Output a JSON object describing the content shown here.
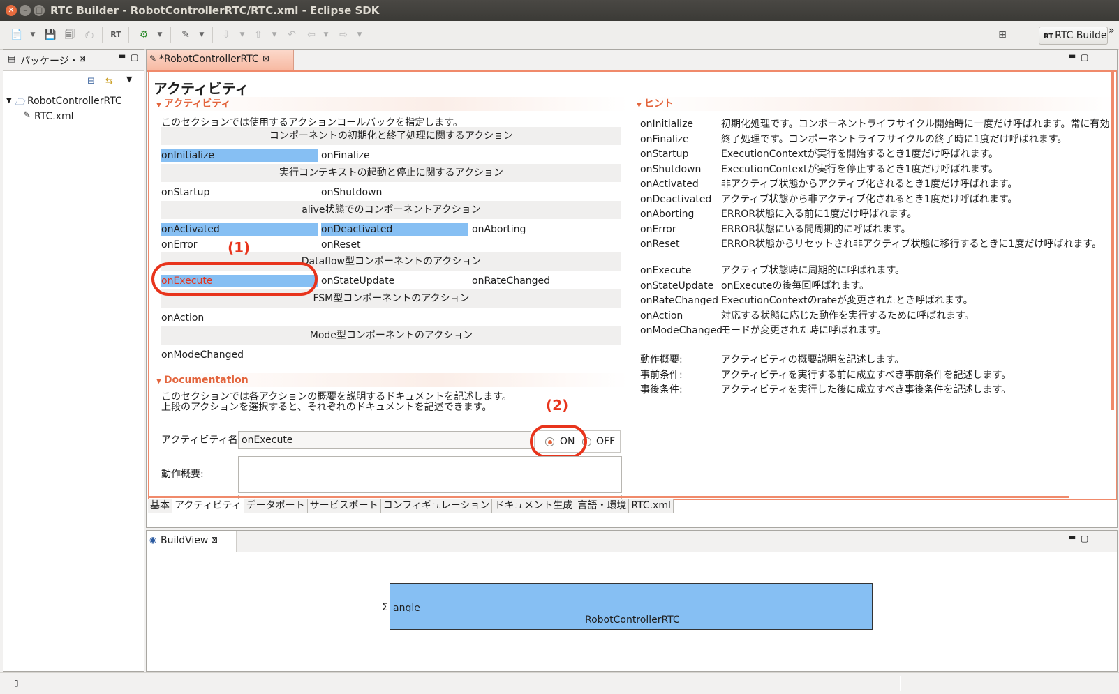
{
  "window": {
    "title": "RTC Builder - RobotControllerRTC/RTC.xml - Eclipse SDK"
  },
  "toolbar": {
    "perspective_label": "RTC Builde",
    "overflow": "»"
  },
  "package_explorer": {
    "tab_label": "パッケージ・",
    "tree": {
      "project": "RobotControllerRTC",
      "file": "RTC.xml"
    }
  },
  "editor": {
    "tab_label": "*RobotControllerRTC",
    "page_title": "アクティビティ",
    "activity_section": {
      "header": "アクティビティ",
      "description": "このセクションでは使用するアクションコールバックを指定します。",
      "groups": [
        {
          "title": "コンポーネントの初期化と終了処理に関するアクション",
          "actions": [
            "onInitialize",
            "onFinalize"
          ]
        },
        {
          "title": "実行コンテキストの起動と停止に関するアクション",
          "actions": [
            "onStartup",
            "onShutdown"
          ]
        },
        {
          "title": "alive状態でのコンポーネントアクション",
          "actions": [
            "onActivated",
            "onDeactivated",
            "onAborting",
            "onError",
            "onReset"
          ]
        },
        {
          "title": "Dataflow型コンポーネントのアクション",
          "actions": [
            "onExecute",
            "onStateUpdate",
            "onRateChanged"
          ]
        },
        {
          "title": "FSM型コンポーネントのアクション",
          "actions": [
            "onAction"
          ]
        },
        {
          "title": "Mode型コンポーネントのアクション",
          "actions": [
            "onModeChanged"
          ]
        }
      ]
    },
    "documentation_section": {
      "header": "Documentation",
      "description_line1": "このセクションでは各アクションの概要を説明するドキュメントを記述します。",
      "description_line2": "上段のアクションを選択すると、それぞれのドキュメントを記述できます。",
      "activity_name_label": "アクティビティ名 :",
      "activity_name_value": "onExecute",
      "radio_on": "ON",
      "radio_off": "OFF",
      "radio_selected": "ON",
      "summary_label": "動作概要:"
    },
    "hint_section": {
      "header": "ヒント",
      "hints": [
        {
          "key": "onInitialize",
          "text": "初期化処理です。コンポーネントライフサイクル開始時に一度だけ呼ばれます。常に有効"
        },
        {
          "key": "onFinalize",
          "text": "終了処理です。コンポーネントライフサイクルの終了時に1度だけ呼ばれます。"
        },
        {
          "key": "onStartup",
          "text": "ExecutionContextが実行を開始するとき1度だけ呼ばれます。"
        },
        {
          "key": "onShutdown",
          "text": "ExecutionContextが実行を停止するとき1度だけ呼ばれます。"
        },
        {
          "key": "onActivated",
          "text": "非アクティブ状態からアクティブ化されるとき1度だけ呼ばれます。"
        },
        {
          "key": "onDeactivated",
          "text": "アクティブ状態から非アクティブ化されるとき1度だけ呼ばれます。"
        },
        {
          "key": "onAborting",
          "text": "ERROR状態に入る前に1度だけ呼ばれます。"
        },
        {
          "key": "onError",
          "text": "ERROR状態にいる間周期的に呼ばれます。"
        },
        {
          "key": "onReset",
          "text": "ERROR状態からリセットされ非アクティブ状態に移行するときに1度だけ呼ばれます。"
        },
        {
          "key": "onExecute",
          "text": "アクティブ状態時に周期的に呼ばれます。"
        },
        {
          "key": "onStateUpdate",
          "text": "onExecuteの後毎回呼ばれます。"
        },
        {
          "key": "onRateChanged",
          "text": "ExecutionContextのrateが変更されたとき呼ばれます。"
        },
        {
          "key": "onAction",
          "text": "対応する状態に応じた動作を実行するために呼ばれます。"
        },
        {
          "key": "onModeChanged",
          "text": "モードが変更された時に呼ばれます。"
        },
        {
          "key": "動作概要:",
          "text": "アクティビティの概要説明を記述します。"
        },
        {
          "key": "事前条件:",
          "text": "アクティビティを実行する前に成立すべき事前条件を記述します。"
        },
        {
          "key": "事後条件:",
          "text": "アクティビティを実行した後に成立すべき事後条件を記述します。"
        }
      ]
    },
    "bottom_tabs": [
      "基本",
      "アクティビティ",
      "データポート",
      "サービスポート",
      "コンフィギュレーション",
      "ドキュメント生成",
      "言語・環境",
      "RTC.xml"
    ],
    "active_bottom_tab": "アクティビティ"
  },
  "annotations": {
    "callout_1": "(1)",
    "callout_2": "(2)",
    "color": "#e8341c"
  },
  "build_view": {
    "tab_label": "BuildView",
    "component_name": "RobotControllerRTC",
    "port_label": "angle",
    "port_symbol": "Σ"
  },
  "colors": {
    "accent": "#f08a6b",
    "selection": "#86bff3",
    "section_header": "#e3643c"
  }
}
